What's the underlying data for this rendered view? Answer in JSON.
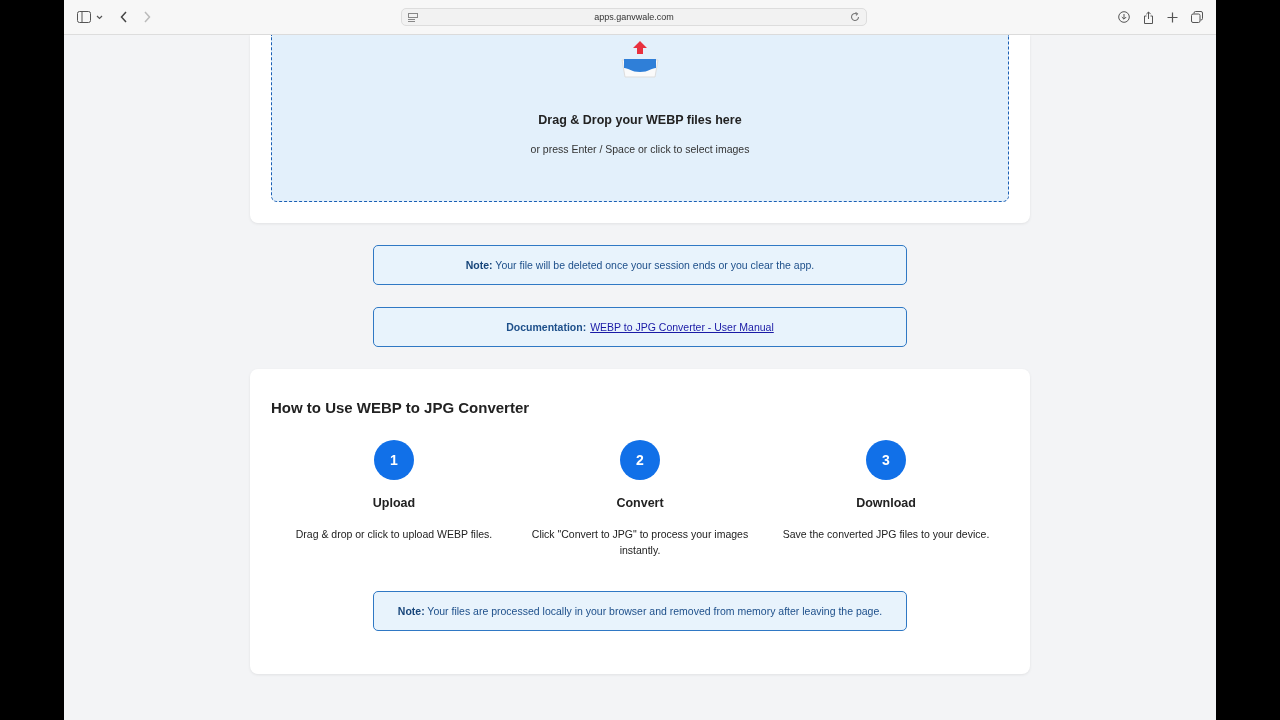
{
  "browser": {
    "address": "apps.ganvwale.com"
  },
  "upload": {
    "title": "Drag & Drop your WEBP files here",
    "hint": "or press Enter / Space or click to select images"
  },
  "session_note": "**Note:** Your file will be deleted once your session ends or you clear the app.",
  "documentation": {
    "label": "Documentation:",
    "link": "WEBP to JPG Converter - User Manual"
  },
  "how_to": {
    "title": "How to Use WEBP to JPG Converter",
    "steps": [
      {
        "number": "1",
        "title": "Upload",
        "text": "Drag & drop or click to upload WEBP files."
      },
      {
        "number": "2",
        "title": "Convert",
        "text": "Click \"Convert to JPG\" to process your images instantly."
      },
      {
        "number": "3",
        "title": "Download",
        "text": "Save the converted JPG files to your device."
      }
    ],
    "note": "**Note:** Your files are processed locally in your browser and removed from memory after leaving the page."
  }
}
